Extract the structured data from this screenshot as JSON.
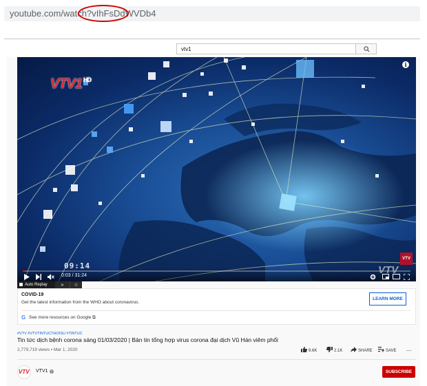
{
  "browser": {
    "url_prefix": "youtube.com/watch?v",
    "url_id": "IhFsDdWVDb4"
  },
  "search": {
    "value": "vtv1",
    "icon": "search-icon"
  },
  "player": {
    "overlay_logo": "VTV1",
    "overlay_logo_hd": "HD",
    "overlay_clock": "09:14",
    "corner_badge": "VTV",
    "watermark": "VTV",
    "current_time": "0:03",
    "duration": "31:24",
    "time_display": "0:03 / 31:24",
    "progress_fraction": 0.0016,
    "progress_color": "#ff0000"
  },
  "autoreplay": {
    "label": "Auto Replay",
    "forward": "»",
    "star": "☆"
  },
  "covid_panel": {
    "title": "COVID-19",
    "description": "Get the latest information from the WHO about coronavirus.",
    "learn_more": "LEARN MORE",
    "more_resources": "See more resources on Google"
  },
  "video": {
    "tags": "#VTV #VTVTINTUCTHOISU #TINTUC",
    "title": "Tin tức dịch bệnh corona sáng 01/03/2020 | Bản tin tổng hợp virus corona đại dịch Vũ Hán viêm phổi",
    "meta": "2,779,719 views • Mar 1, 2020",
    "likes": "9.6K",
    "dislikes": "2.1K",
    "share": "SHARE",
    "save": "SAVE",
    "more": "..."
  },
  "channel": {
    "name": "VTV1",
    "avatar_text": "VTV",
    "subscribe": "SUBSCRIBE"
  },
  "colors": {
    "accent_red": "#cc0000",
    "link_blue": "#065fd4"
  }
}
